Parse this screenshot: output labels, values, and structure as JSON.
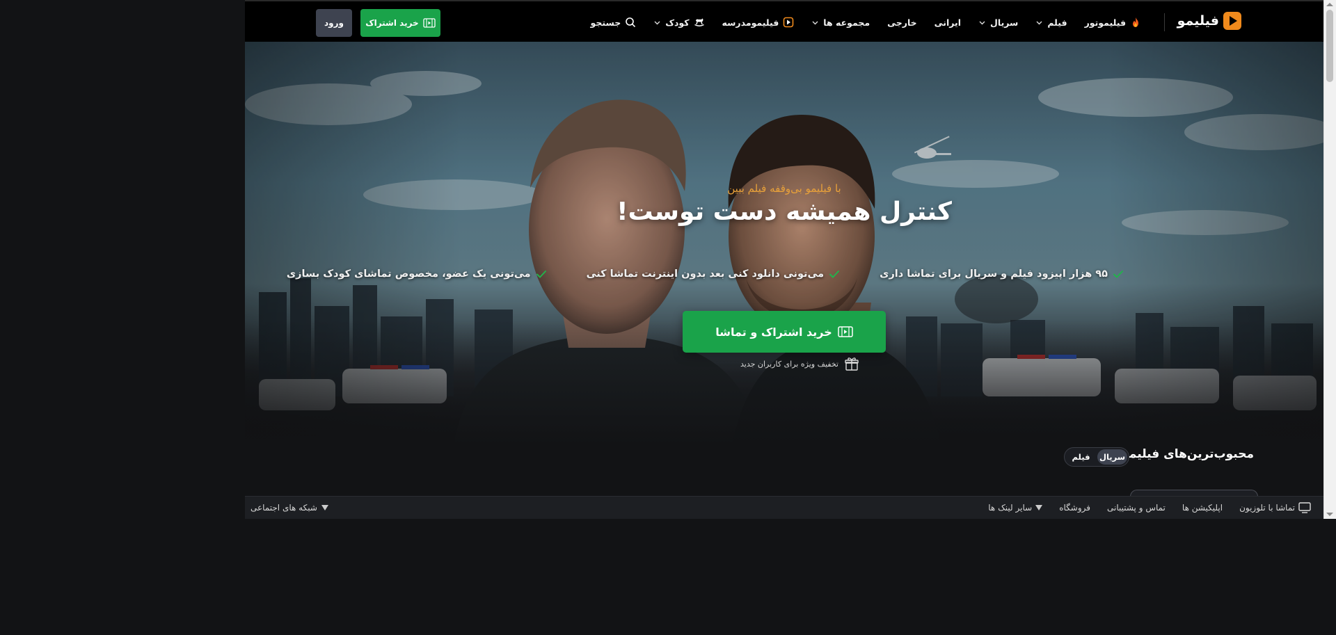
{
  "header": {
    "logo_text": "فیلیمو",
    "nav": {
      "filimotor": "فیلیموتور",
      "film": "فیلم",
      "serial": "سریال",
      "irani": "ایرانی",
      "khareji": "خارجی",
      "collections": "مجموعه ها",
      "filimo_school": "فیلیمومدرسه",
      "kids": "کودک",
      "search": "جستجو"
    },
    "subscribe_button": "خرید اشتراک",
    "login_button": "ورود"
  },
  "hero": {
    "tagline": "با فیلیمو بی‌وقفه فیلم ببین",
    "title": "کنترل همیشه دست توست!",
    "features": [
      "۹۵ هزار اپیزود فیلم و سریال برای تماشا داری",
      "می‌تونی دانلود کنی بعد بدون اینترنت تماشا کنی",
      "می‌تونی یک عضو، مخصوص تماشای کودک بسازی"
    ],
    "cta_button": "خرید اشتراک و تماشا",
    "discount_note": "تخفیف ویژه برای کاربران جدید"
  },
  "popular": {
    "title": "محبوب‌ترین‌های فیلیمو",
    "toggle": {
      "serial": "سریال",
      "film": "فیلم",
      "active": "serial"
    }
  },
  "footer": {
    "tv": "تماشا با تلوزیون",
    "apps": "اپلیکیشن ها",
    "contact": "تماس و پشتیبانی",
    "shop": "فروشگاه",
    "other_links": "سایر لینک ها",
    "social": "شبکه های اجتماعی"
  },
  "colors": {
    "accent_green": "#1aa34a",
    "tagline_orange": "#e8a13a",
    "logo_orange": "#f08a1c",
    "check_green": "#22b24c"
  }
}
